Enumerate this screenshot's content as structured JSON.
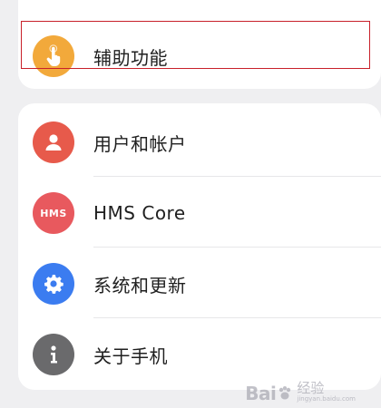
{
  "top_section": {
    "items": [
      {
        "label": "辅助功能",
        "icon": "accessibility-touch-icon",
        "color": "#f2a93b"
      }
    ]
  },
  "main_section": {
    "items": [
      {
        "label": "用户和帐户",
        "icon": "user-account-icon",
        "color": "#e75a4b"
      },
      {
        "label": "HMS Core",
        "icon": "hms-core-icon",
        "icon_text": "HMS",
        "color": "#e8595e"
      },
      {
        "label": "系统和更新",
        "icon": "gear-icon",
        "color": "#3b7cf0"
      },
      {
        "label": "关于手机",
        "icon": "info-icon",
        "color": "#6a6a6c"
      }
    ]
  },
  "highlight": {
    "color": "#c8202a"
  },
  "watermark": {
    "brand": "Bai",
    "brand_suffix": "经验",
    "url": "jingyan.baidu.com"
  }
}
